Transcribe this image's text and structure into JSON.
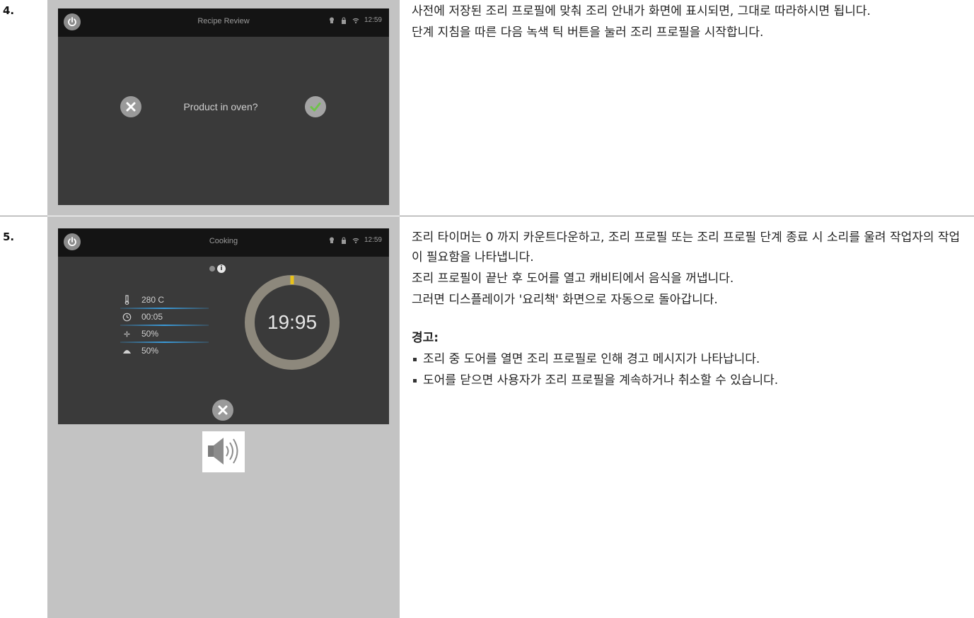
{
  "steps": [
    {
      "number": "4.",
      "screen": {
        "title": "Recipe Review",
        "time": "12:59",
        "prompt": "Product in oven?"
      },
      "text": [
        "사전에 저장된 조리 프로필에 맞춰 조리 안내가 화면에 표시되면, 그대로 따라하시면 됩니다.",
        "단계 지침을 따른 다음 녹색 틱 버튼을 눌러 조리 프로필을 시작합니다."
      ]
    },
    {
      "number": "5.",
      "screen": {
        "title": "Cooking",
        "time": "12:59",
        "params": [
          "280 C",
          "00:05",
          "50%",
          "50%"
        ],
        "timer": "19:95"
      },
      "text": [
        "조리 타이머는 0 까지 카운트다운하고, 조리 프로필 또는 조리 프로필 단계 종료 시 소리를 울려 작업자의 작업이 필요함을 나타냅니다.",
        "조리 프로필이 끝난 후 도어를 열고 캐비티에서 음식을 꺼냅니다.",
        "그러면 디스플레이가 '요리책' 화면으로 자동으로 돌아갑니다."
      ],
      "warning_title": "경고:",
      "warning_items": [
        "조리 중 도어를 열면 조리 프로필로 인해 경고 메시지가 나타납니다.",
        "도어를 닫으면 사용자가 조리 프로필을 계속하거나 취소할 수 있습니다."
      ]
    }
  ],
  "colors": {
    "screen_bg": "#3a3a3a",
    "topbar_bg": "#141414",
    "confirm_green": "#6fc24a",
    "timer_ring": "#8d887c",
    "progress_yellow": "#e8c21a",
    "param_underline": "#3a9ad9"
  }
}
